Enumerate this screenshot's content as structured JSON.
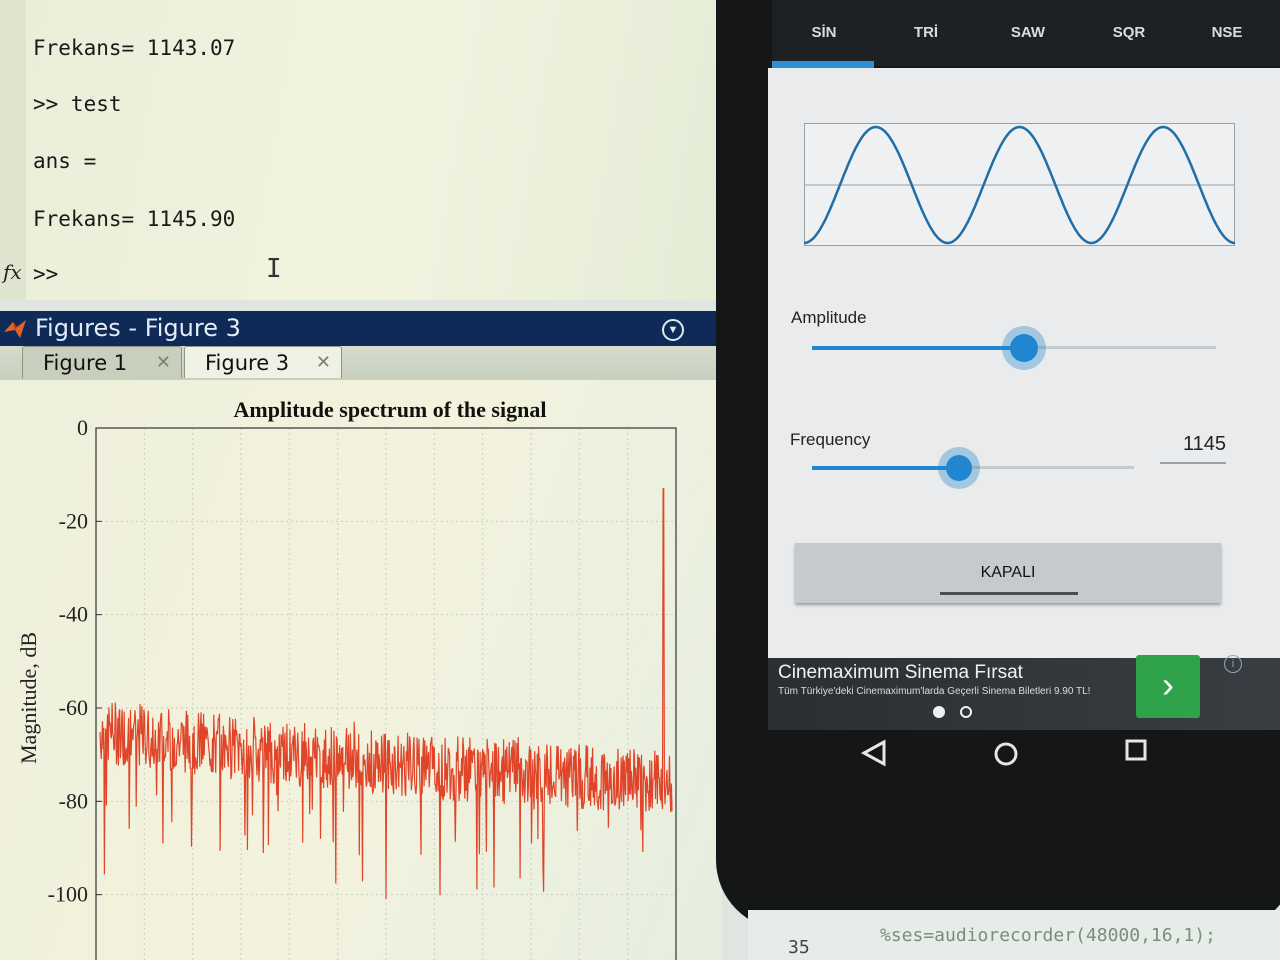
{
  "command_window": {
    "lines": [
      "Frekans= 1143.07",
      ">> test",
      "ans =",
      "Frekans= 1145.90",
      ">>"
    ],
    "fx_label": "fx"
  },
  "figures_window": {
    "title": "Figures - Figure 3",
    "tabs": [
      {
        "label": "Figure 1",
        "active": false
      },
      {
        "label": "Figure 3",
        "active": true
      }
    ]
  },
  "chart_data": {
    "type": "line",
    "title": "Amplitude spectrum of the signal",
    "xlabel": "",
    "ylabel": "Magnitude, dB",
    "ylim": [
      -120,
      0
    ],
    "yticks": [
      0,
      -20,
      -40,
      -60,
      -80,
      -100
    ],
    "grid": true,
    "series": [
      {
        "color": "#e0452a",
        "noise_floor_trend": [
          [
            0,
            -65
          ],
          [
            0.5,
            -72
          ],
          [
            1.0,
            -76
          ]
        ],
        "peak_x_fraction": 0.985,
        "peak_db": -13
      }
    ]
  },
  "phone": {
    "wave_tabs": [
      "SİN",
      "TRİ",
      "SAW",
      "SQR",
      "NSE"
    ],
    "active_tab": "SİN",
    "amplitude": {
      "label": "Amplitude",
      "value_fraction": 0.52
    },
    "frequency": {
      "label": "Frequency",
      "value": "1145",
      "value_fraction": 0.45
    },
    "toggle_button": "KAPALI",
    "ad": {
      "title": "Cinemaximum Sinema Fırsat",
      "description": "Tüm Türkiye'deki Cinemaximum'larda Geçerli Sinema Biletleri 9.90 TL!",
      "info_icon": "i"
    },
    "nav": [
      "back-icon",
      "home-icon",
      "recents-icon"
    ]
  },
  "editor": {
    "line_number": "35",
    "code": "%ses=audiorecorder(48000,16,1);"
  },
  "colors": {
    "figure_titlebar": "#0f2a57",
    "accent_blue": "#1f86cf",
    "spectrum_red": "#e0452a",
    "ad_green": "#2fa24a"
  }
}
